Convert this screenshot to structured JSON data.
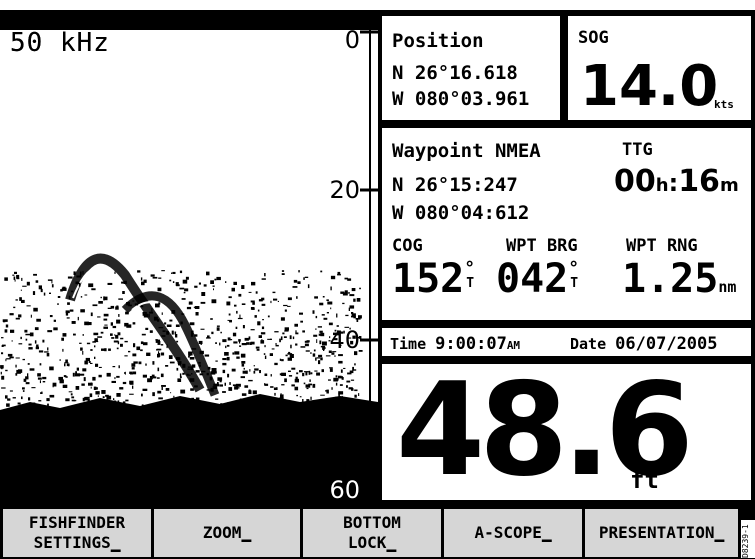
{
  "fishfinder": {
    "frequency": "50 kHz",
    "depth_scale": [
      "0",
      "20",
      "40",
      "60"
    ]
  },
  "position": {
    "label": "Position",
    "lat": "N  26°16.618",
    "lon": "W 080°03.961"
  },
  "sog": {
    "label": "SOG",
    "value": "14.0",
    "unit": "kts"
  },
  "waypoint": {
    "label": "Waypoint NMEA",
    "lat": "N  26°15:247",
    "lon": "W 080°04:612"
  },
  "ttg": {
    "label": "TTG",
    "hours": "00",
    "h_unit": "h",
    "sep": ":",
    "minutes": "16",
    "m_unit": "m"
  },
  "cog": {
    "label": "COG",
    "value": "152",
    "deg": "°",
    "ref": "T"
  },
  "wpt_brg": {
    "label": "WPT BRG",
    "value": "042",
    "deg": "°",
    "ref": "T"
  },
  "wpt_rng": {
    "label": "WPT RNG",
    "value": "1.25",
    "unit": "nm"
  },
  "time": {
    "label": "Time",
    "value": "9:00:07",
    "suffix": "AM"
  },
  "date": {
    "label": "Date",
    "value": "06/07/2005"
  },
  "depth": {
    "value": "48.6",
    "unit": "ft"
  },
  "softkeys": [
    {
      "line1": "FISHFINDER",
      "line2": "SETTINGS"
    },
    {
      "line1": "ZOOM",
      "line2": ""
    },
    {
      "line1": "BOTTOM",
      "line2": "LOCK"
    },
    {
      "line1": "A-SCOPE",
      "line2": ""
    },
    {
      "line1": "PRESENTATION",
      "line2": ""
    }
  ],
  "figure_code": "D8239-1"
}
